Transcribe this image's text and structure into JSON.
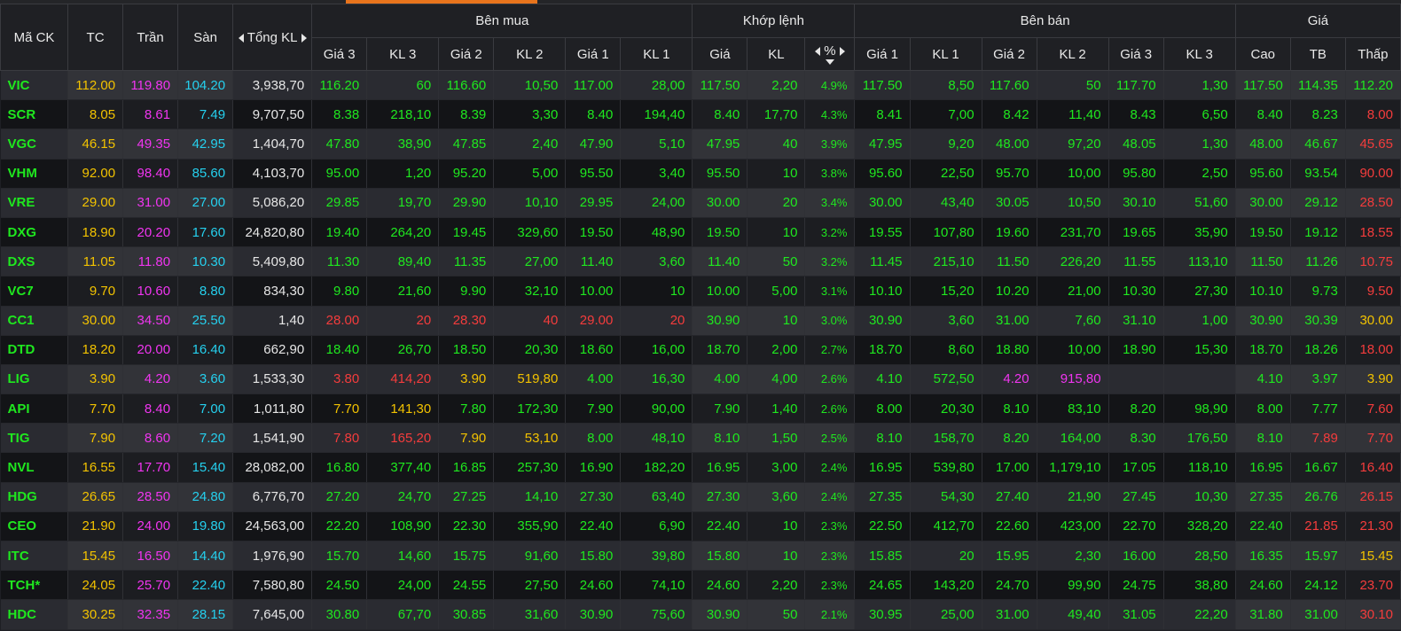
{
  "colors": {
    "green": "#1fe81f",
    "red": "#f43c3c",
    "yellow": "#f2c200",
    "magenta": "#f035f0",
    "cyan": "#25d0ee",
    "white": "#e6e6e6"
  },
  "header": {
    "ma_ck": "Mã CK",
    "tc": "TC",
    "tran": "Trần",
    "san": "Sàn",
    "tong_kl": "Tổng KL",
    "ben_mua": "Bên mua",
    "khop_lenh": "Khớp lệnh",
    "ben_ban": "Bên bán",
    "gia_group": "Giá",
    "buy_cols": [
      "Giá 3",
      "KL 3",
      "Giá 2",
      "KL 2",
      "Giá 1",
      "KL 1"
    ],
    "match_cols": [
      "Giá",
      "KL",
      "%"
    ],
    "sell_cols": [
      "Giá 1",
      "KL 1",
      "Giá 2",
      "KL 2",
      "Giá 3",
      "KL 3"
    ],
    "price_cols": [
      "Cao",
      "TB",
      "Thấp"
    ]
  },
  "rows": [
    {
      "c": [
        "VIC",
        "112.00",
        "119.80",
        "104.20",
        "3,938,70",
        "116.20",
        "60",
        "116.60",
        "10,50",
        "117.00",
        "28,00",
        "117.50",
        "2,20",
        "4.9%",
        "117.50",
        "8,50",
        "117.60",
        "50",
        "117.70",
        "1,30",
        "117.50",
        "114.35",
        "112.20"
      ],
      "k": [
        "g",
        "y",
        "m",
        "c",
        "w",
        "g",
        "g",
        "g",
        "g",
        "g",
        "g",
        "g",
        "g",
        "g",
        "g",
        "g",
        "g",
        "g",
        "g",
        "g",
        "g",
        "g",
        "g"
      ]
    },
    {
      "c": [
        "SCR",
        "8.05",
        "8.61",
        "7.49",
        "9,707,50",
        "8.38",
        "218,10",
        "8.39",
        "3,30",
        "8.40",
        "194,40",
        "8.40",
        "17,70",
        "4.3%",
        "8.41",
        "7,00",
        "8.42",
        "11,40",
        "8.43",
        "6,50",
        "8.40",
        "8.23",
        "8.00"
      ],
      "k": [
        "g",
        "y",
        "m",
        "c",
        "w",
        "g",
        "g",
        "g",
        "g",
        "g",
        "g",
        "g",
        "g",
        "g",
        "g",
        "g",
        "g",
        "g",
        "g",
        "g",
        "g",
        "g",
        "r"
      ]
    },
    {
      "c": [
        "VGC",
        "46.15",
        "49.35",
        "42.95",
        "1,404,70",
        "47.80",
        "38,90",
        "47.85",
        "2,40",
        "47.90",
        "5,10",
        "47.95",
        "40",
        "3.9%",
        "47.95",
        "9,20",
        "48.00",
        "97,20",
        "48.05",
        "1,30",
        "48.00",
        "46.67",
        "45.65"
      ],
      "k": [
        "g",
        "y",
        "m",
        "c",
        "w",
        "g",
        "g",
        "g",
        "g",
        "g",
        "g",
        "g",
        "g",
        "g",
        "g",
        "g",
        "g",
        "g",
        "g",
        "g",
        "g",
        "g",
        "r"
      ]
    },
    {
      "c": [
        "VHM",
        "92.00",
        "98.40",
        "85.60",
        "4,103,70",
        "95.00",
        "1,20",
        "95.20",
        "5,00",
        "95.50",
        "3,40",
        "95.50",
        "10",
        "3.8%",
        "95.60",
        "22,50",
        "95.70",
        "10,00",
        "95.80",
        "2,50",
        "95.60",
        "93.54",
        "90.00"
      ],
      "k": [
        "g",
        "y",
        "m",
        "c",
        "w",
        "g",
        "g",
        "g",
        "g",
        "g",
        "g",
        "g",
        "g",
        "g",
        "g",
        "g",
        "g",
        "g",
        "g",
        "g",
        "g",
        "g",
        "r"
      ]
    },
    {
      "c": [
        "VRE",
        "29.00",
        "31.00",
        "27.00",
        "5,086,20",
        "29.85",
        "19,70",
        "29.90",
        "10,10",
        "29.95",
        "24,00",
        "30.00",
        "20",
        "3.4%",
        "30.00",
        "43,40",
        "30.05",
        "10,50",
        "30.10",
        "51,60",
        "30.00",
        "29.12",
        "28.50"
      ],
      "k": [
        "g",
        "y",
        "m",
        "c",
        "w",
        "g",
        "g",
        "g",
        "g",
        "g",
        "g",
        "g",
        "g",
        "g",
        "g",
        "g",
        "g",
        "g",
        "g",
        "g",
        "g",
        "g",
        "r"
      ]
    },
    {
      "c": [
        "DXG",
        "18.90",
        "20.20",
        "17.60",
        "24,820,80",
        "19.40",
        "264,20",
        "19.45",
        "329,60",
        "19.50",
        "48,90",
        "19.50",
        "10",
        "3.2%",
        "19.55",
        "107,80",
        "19.60",
        "231,70",
        "19.65",
        "35,90",
        "19.50",
        "19.12",
        "18.55"
      ],
      "k": [
        "g",
        "y",
        "m",
        "c",
        "w",
        "g",
        "g",
        "g",
        "g",
        "g",
        "g",
        "g",
        "g",
        "g",
        "g",
        "g",
        "g",
        "g",
        "g",
        "g",
        "g",
        "g",
        "r"
      ]
    },
    {
      "c": [
        "DXS",
        "11.05",
        "11.80",
        "10.30",
        "5,409,80",
        "11.30",
        "89,40",
        "11.35",
        "27,00",
        "11.40",
        "3,60",
        "11.40",
        "50",
        "3.2%",
        "11.45",
        "215,10",
        "11.50",
        "226,20",
        "11.55",
        "113,10",
        "11.50",
        "11.26",
        "10.75"
      ],
      "k": [
        "g",
        "y",
        "m",
        "c",
        "w",
        "g",
        "g",
        "g",
        "g",
        "g",
        "g",
        "g",
        "g",
        "g",
        "g",
        "g",
        "g",
        "g",
        "g",
        "g",
        "g",
        "g",
        "r"
      ]
    },
    {
      "c": [
        "VC7",
        "9.70",
        "10.60",
        "8.80",
        "834,30",
        "9.80",
        "21,60",
        "9.90",
        "32,10",
        "10.00",
        "10",
        "10.00",
        "5,00",
        "3.1%",
        "10.10",
        "15,20",
        "10.20",
        "21,00",
        "10.30",
        "27,30",
        "10.10",
        "9.73",
        "9.50"
      ],
      "k": [
        "g",
        "y",
        "m",
        "c",
        "w",
        "g",
        "g",
        "g",
        "g",
        "g",
        "g",
        "g",
        "g",
        "g",
        "g",
        "g",
        "g",
        "g",
        "g",
        "g",
        "g",
        "g",
        "r"
      ]
    },
    {
      "c": [
        "CC1",
        "30.00",
        "34.50",
        "25.50",
        "1,40",
        "28.00",
        "20",
        "28.30",
        "40",
        "29.00",
        "20",
        "30.90",
        "10",
        "3.0%",
        "30.90",
        "3,60",
        "31.00",
        "7,60",
        "31.10",
        "1,00",
        "30.90",
        "30.39",
        "30.00"
      ],
      "k": [
        "g",
        "y",
        "m",
        "c",
        "w",
        "r",
        "r",
        "r",
        "r",
        "r",
        "r",
        "g",
        "g",
        "g",
        "g",
        "g",
        "g",
        "g",
        "g",
        "g",
        "g",
        "g",
        "y"
      ]
    },
    {
      "c": [
        "DTD",
        "18.20",
        "20.00",
        "16.40",
        "662,90",
        "18.40",
        "26,70",
        "18.50",
        "20,30",
        "18.60",
        "16,00",
        "18.70",
        "2,00",
        "2.7%",
        "18.70",
        "8,60",
        "18.80",
        "10,00",
        "18.90",
        "15,30",
        "18.70",
        "18.26",
        "18.00"
      ],
      "k": [
        "g",
        "y",
        "m",
        "c",
        "w",
        "g",
        "g",
        "g",
        "g",
        "g",
        "g",
        "g",
        "g",
        "g",
        "g",
        "g",
        "g",
        "g",
        "g",
        "g",
        "g",
        "g",
        "r"
      ]
    },
    {
      "c": [
        "LIG",
        "3.90",
        "4.20",
        "3.60",
        "1,533,30",
        "3.80",
        "414,20",
        "3.90",
        "519,80",
        "4.00",
        "16,30",
        "4.00",
        "4,00",
        "2.6%",
        "4.10",
        "572,50",
        "4.20",
        "915,80",
        "",
        "",
        "4.10",
        "3.97",
        "3.90"
      ],
      "k": [
        "g",
        "y",
        "m",
        "c",
        "w",
        "r",
        "r",
        "y",
        "y",
        "g",
        "g",
        "g",
        "g",
        "g",
        "g",
        "g",
        "m",
        "m",
        "g",
        "g",
        "g",
        "g",
        "y"
      ]
    },
    {
      "c": [
        "API",
        "7.70",
        "8.40",
        "7.00",
        "1,011,80",
        "7.70",
        "141,30",
        "7.80",
        "172,30",
        "7.90",
        "90,00",
        "7.90",
        "1,40",
        "2.6%",
        "8.00",
        "20,30",
        "8.10",
        "83,10",
        "8.20",
        "98,90",
        "8.00",
        "7.77",
        "7.60"
      ],
      "k": [
        "g",
        "y",
        "m",
        "c",
        "w",
        "y",
        "y",
        "g",
        "g",
        "g",
        "g",
        "g",
        "g",
        "g",
        "g",
        "g",
        "g",
        "g",
        "g",
        "g",
        "g",
        "g",
        "r"
      ]
    },
    {
      "c": [
        "TIG",
        "7.90",
        "8.60",
        "7.20",
        "1,541,90",
        "7.80",
        "165,20",
        "7.90",
        "53,10",
        "8.00",
        "48,10",
        "8.10",
        "1,50",
        "2.5%",
        "8.10",
        "158,70",
        "8.20",
        "164,00",
        "8.30",
        "176,50",
        "8.10",
        "7.89",
        "7.70"
      ],
      "k": [
        "g",
        "y",
        "m",
        "c",
        "w",
        "r",
        "r",
        "y",
        "y",
        "g",
        "g",
        "g",
        "g",
        "g",
        "g",
        "g",
        "g",
        "g",
        "g",
        "g",
        "g",
        "r",
        "r"
      ]
    },
    {
      "c": [
        "NVL",
        "16.55",
        "17.70",
        "15.40",
        "28,082,00",
        "16.80",
        "377,40",
        "16.85",
        "257,30",
        "16.90",
        "182,20",
        "16.95",
        "3,00",
        "2.4%",
        "16.95",
        "539,80",
        "17.00",
        "1,179,10",
        "17.05",
        "118,10",
        "16.95",
        "16.67",
        "16.40"
      ],
      "k": [
        "g",
        "y",
        "m",
        "c",
        "w",
        "g",
        "g",
        "g",
        "g",
        "g",
        "g",
        "g",
        "g",
        "g",
        "g",
        "g",
        "g",
        "g",
        "g",
        "g",
        "g",
        "g",
        "r"
      ]
    },
    {
      "c": [
        "HDG",
        "26.65",
        "28.50",
        "24.80",
        "6,776,70",
        "27.20",
        "24,70",
        "27.25",
        "14,10",
        "27.30",
        "63,40",
        "27.30",
        "3,60",
        "2.4%",
        "27.35",
        "54,30",
        "27.40",
        "21,90",
        "27.45",
        "10,30",
        "27.35",
        "26.76",
        "26.15"
      ],
      "k": [
        "g",
        "y",
        "m",
        "c",
        "w",
        "g",
        "g",
        "g",
        "g",
        "g",
        "g",
        "g",
        "g",
        "g",
        "g",
        "g",
        "g",
        "g",
        "g",
        "g",
        "g",
        "g",
        "r"
      ]
    },
    {
      "c": [
        "CEO",
        "21.90",
        "24.00",
        "19.80",
        "24,563,00",
        "22.20",
        "108,90",
        "22.30",
        "355,90",
        "22.40",
        "6,90",
        "22.40",
        "10",
        "2.3%",
        "22.50",
        "412,70",
        "22.60",
        "423,00",
        "22.70",
        "328,20",
        "22.40",
        "21.85",
        "21.30"
      ],
      "k": [
        "g",
        "y",
        "m",
        "c",
        "w",
        "g",
        "g",
        "g",
        "g",
        "g",
        "g",
        "g",
        "g",
        "g",
        "g",
        "g",
        "g",
        "g",
        "g",
        "g",
        "g",
        "r",
        "r"
      ]
    },
    {
      "c": [
        "ITC",
        "15.45",
        "16.50",
        "14.40",
        "1,976,90",
        "15.70",
        "14,60",
        "15.75",
        "91,60",
        "15.80",
        "39,80",
        "15.80",
        "10",
        "2.3%",
        "15.85",
        "20",
        "15.95",
        "2,30",
        "16.00",
        "28,50",
        "16.35",
        "15.97",
        "15.45"
      ],
      "k": [
        "g",
        "y",
        "m",
        "c",
        "w",
        "g",
        "g",
        "g",
        "g",
        "g",
        "g",
        "g",
        "g",
        "g",
        "g",
        "g",
        "g",
        "g",
        "g",
        "g",
        "g",
        "g",
        "y"
      ]
    },
    {
      "c": [
        "TCH*",
        "24.05",
        "25.70",
        "22.40",
        "7,580,80",
        "24.50",
        "24,00",
        "24.55",
        "27,50",
        "24.60",
        "74,10",
        "24.60",
        "2,20",
        "2.3%",
        "24.65",
        "143,20",
        "24.70",
        "99,90",
        "24.75",
        "38,80",
        "24.60",
        "24.12",
        "23.70"
      ],
      "k": [
        "g",
        "y",
        "m",
        "c",
        "w",
        "g",
        "g",
        "g",
        "g",
        "g",
        "g",
        "g",
        "g",
        "g",
        "g",
        "g",
        "g",
        "g",
        "g",
        "g",
        "g",
        "g",
        "r"
      ]
    },
    {
      "c": [
        "HDC",
        "30.25",
        "32.35",
        "28.15",
        "7,645,00",
        "30.80",
        "67,70",
        "30.85",
        "31,60",
        "30.90",
        "75,60",
        "30.90",
        "50",
        "2.1%",
        "30.95",
        "25,00",
        "31.00",
        "49,40",
        "31.05",
        "22,20",
        "31.80",
        "31.00",
        "30.10"
      ],
      "k": [
        "g",
        "y",
        "m",
        "c",
        "w",
        "g",
        "g",
        "g",
        "g",
        "g",
        "g",
        "g",
        "g",
        "g",
        "g",
        "g",
        "g",
        "g",
        "g",
        "g",
        "g",
        "g",
        "r"
      ]
    }
  ]
}
